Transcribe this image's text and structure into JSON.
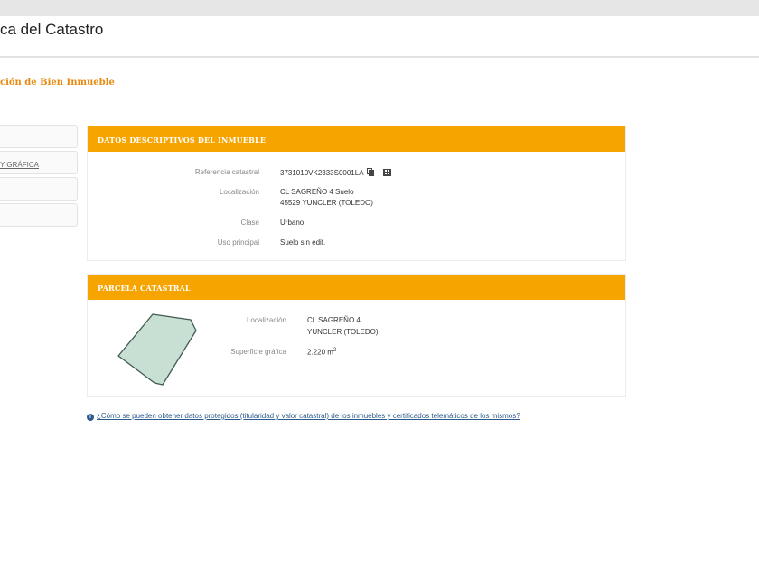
{
  "header": {
    "title": "ca del Catastro"
  },
  "page": {
    "subtitle": "ción de Bien Inmueble"
  },
  "sidebar": {
    "items": [
      {
        "label": ""
      },
      {
        "label": "Y GRÁFICA"
      },
      {
        "label": ""
      },
      {
        "label": ""
      }
    ]
  },
  "descriptive": {
    "title": "DATOS DESCRIPTIVOS DEL INMUEBLE",
    "ref_label": "Referencia catastral",
    "ref_value": "3731010VK2333S0001LA",
    "loc_label": "Localización",
    "loc_line1": "CL SAGREÑO 4 Suelo",
    "loc_line2": "45529 YUNCLER (TOLEDO)",
    "class_label": "Clase",
    "class_value": "Urbano",
    "use_label": "Uso principal",
    "use_value": "Suelo sin edif."
  },
  "parcel": {
    "title": "PARCELA CATASTRAL",
    "loc_label": "Localización",
    "loc_line1": "CL SAGREÑO 4",
    "loc_line2": "YUNCLER (TOLEDO)",
    "surface_label": "Superficie gráfica",
    "surface_value": "2.220 m",
    "surface_unit_sup": "2"
  },
  "info": {
    "link_text": "¿Cómo se pueden obtener datos protegidos (titularidad y valor catastral) de los inmuebles y certificados telemáticos de los mismos?"
  },
  "icons": {
    "copy": "copy-icon",
    "grid": "grid-icon",
    "info": "info-icon"
  },
  "colors": {
    "accent": "#f5a400",
    "subtitle": "#e8890f",
    "parcel_fill": "#c8e0d4",
    "link": "#2a5a8a"
  }
}
